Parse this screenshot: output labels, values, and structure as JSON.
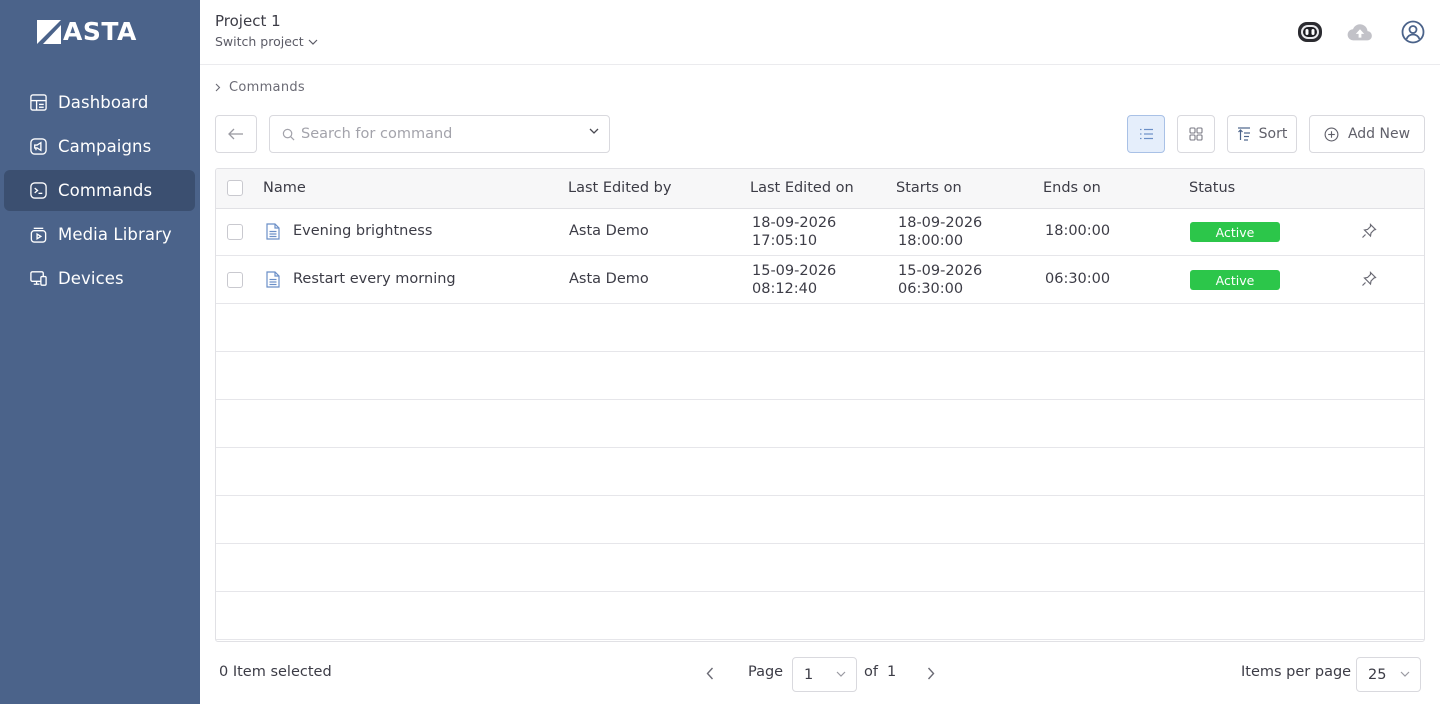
{
  "brand": {
    "name": "ASTA"
  },
  "sidebar": {
    "items": [
      {
        "label": "Dashboard",
        "icon": "dashboard-icon"
      },
      {
        "label": "Campaigns",
        "icon": "campaigns-icon"
      },
      {
        "label": "Commands",
        "icon": "terminal-icon",
        "active": true
      },
      {
        "label": "Media Library",
        "icon": "media-library-icon"
      },
      {
        "label": "Devices",
        "icon": "devices-icon"
      }
    ]
  },
  "header": {
    "project_title": "Project 1",
    "switch_label": "Switch project"
  },
  "breadcrumb": {
    "current": "Commands"
  },
  "toolbar": {
    "search_placeholder": "Search for command",
    "sort_label": "Sort",
    "add_label": "Add New"
  },
  "table": {
    "columns": [
      "Name",
      "Last Edited by",
      "Last Edited on",
      "Starts on",
      "Ends on",
      "Status"
    ],
    "rows": [
      {
        "name": "Evening brightness",
        "edited_by": "Asta Demo",
        "edited_on_date": "18-09-2026",
        "edited_on_time": "17:05:10",
        "starts_date": "18-09-2026",
        "starts_time": "18:00:00",
        "ends": "18:00:00",
        "status": "Active"
      },
      {
        "name": "Restart every morning",
        "edited_by": "Asta Demo",
        "edited_on_date": "15-09-2026",
        "edited_on_time": "08:12:40",
        "starts_date": "15-09-2026",
        "starts_time": "06:30:00",
        "ends": "06:30:00",
        "status": "Active"
      }
    ]
  },
  "footer": {
    "selected_text": "0 Item selected",
    "page_label": "Page",
    "page_value": "1",
    "of_label": "of",
    "total_pages": "1",
    "items_per_page_label": "Items per page",
    "items_per_page_value": "25"
  },
  "colors": {
    "sidebar_bg": "#4b638a",
    "sidebar_active": "#3b4f70",
    "status_active": "#2cc64a",
    "view_active_bg": "#e5eefb"
  }
}
